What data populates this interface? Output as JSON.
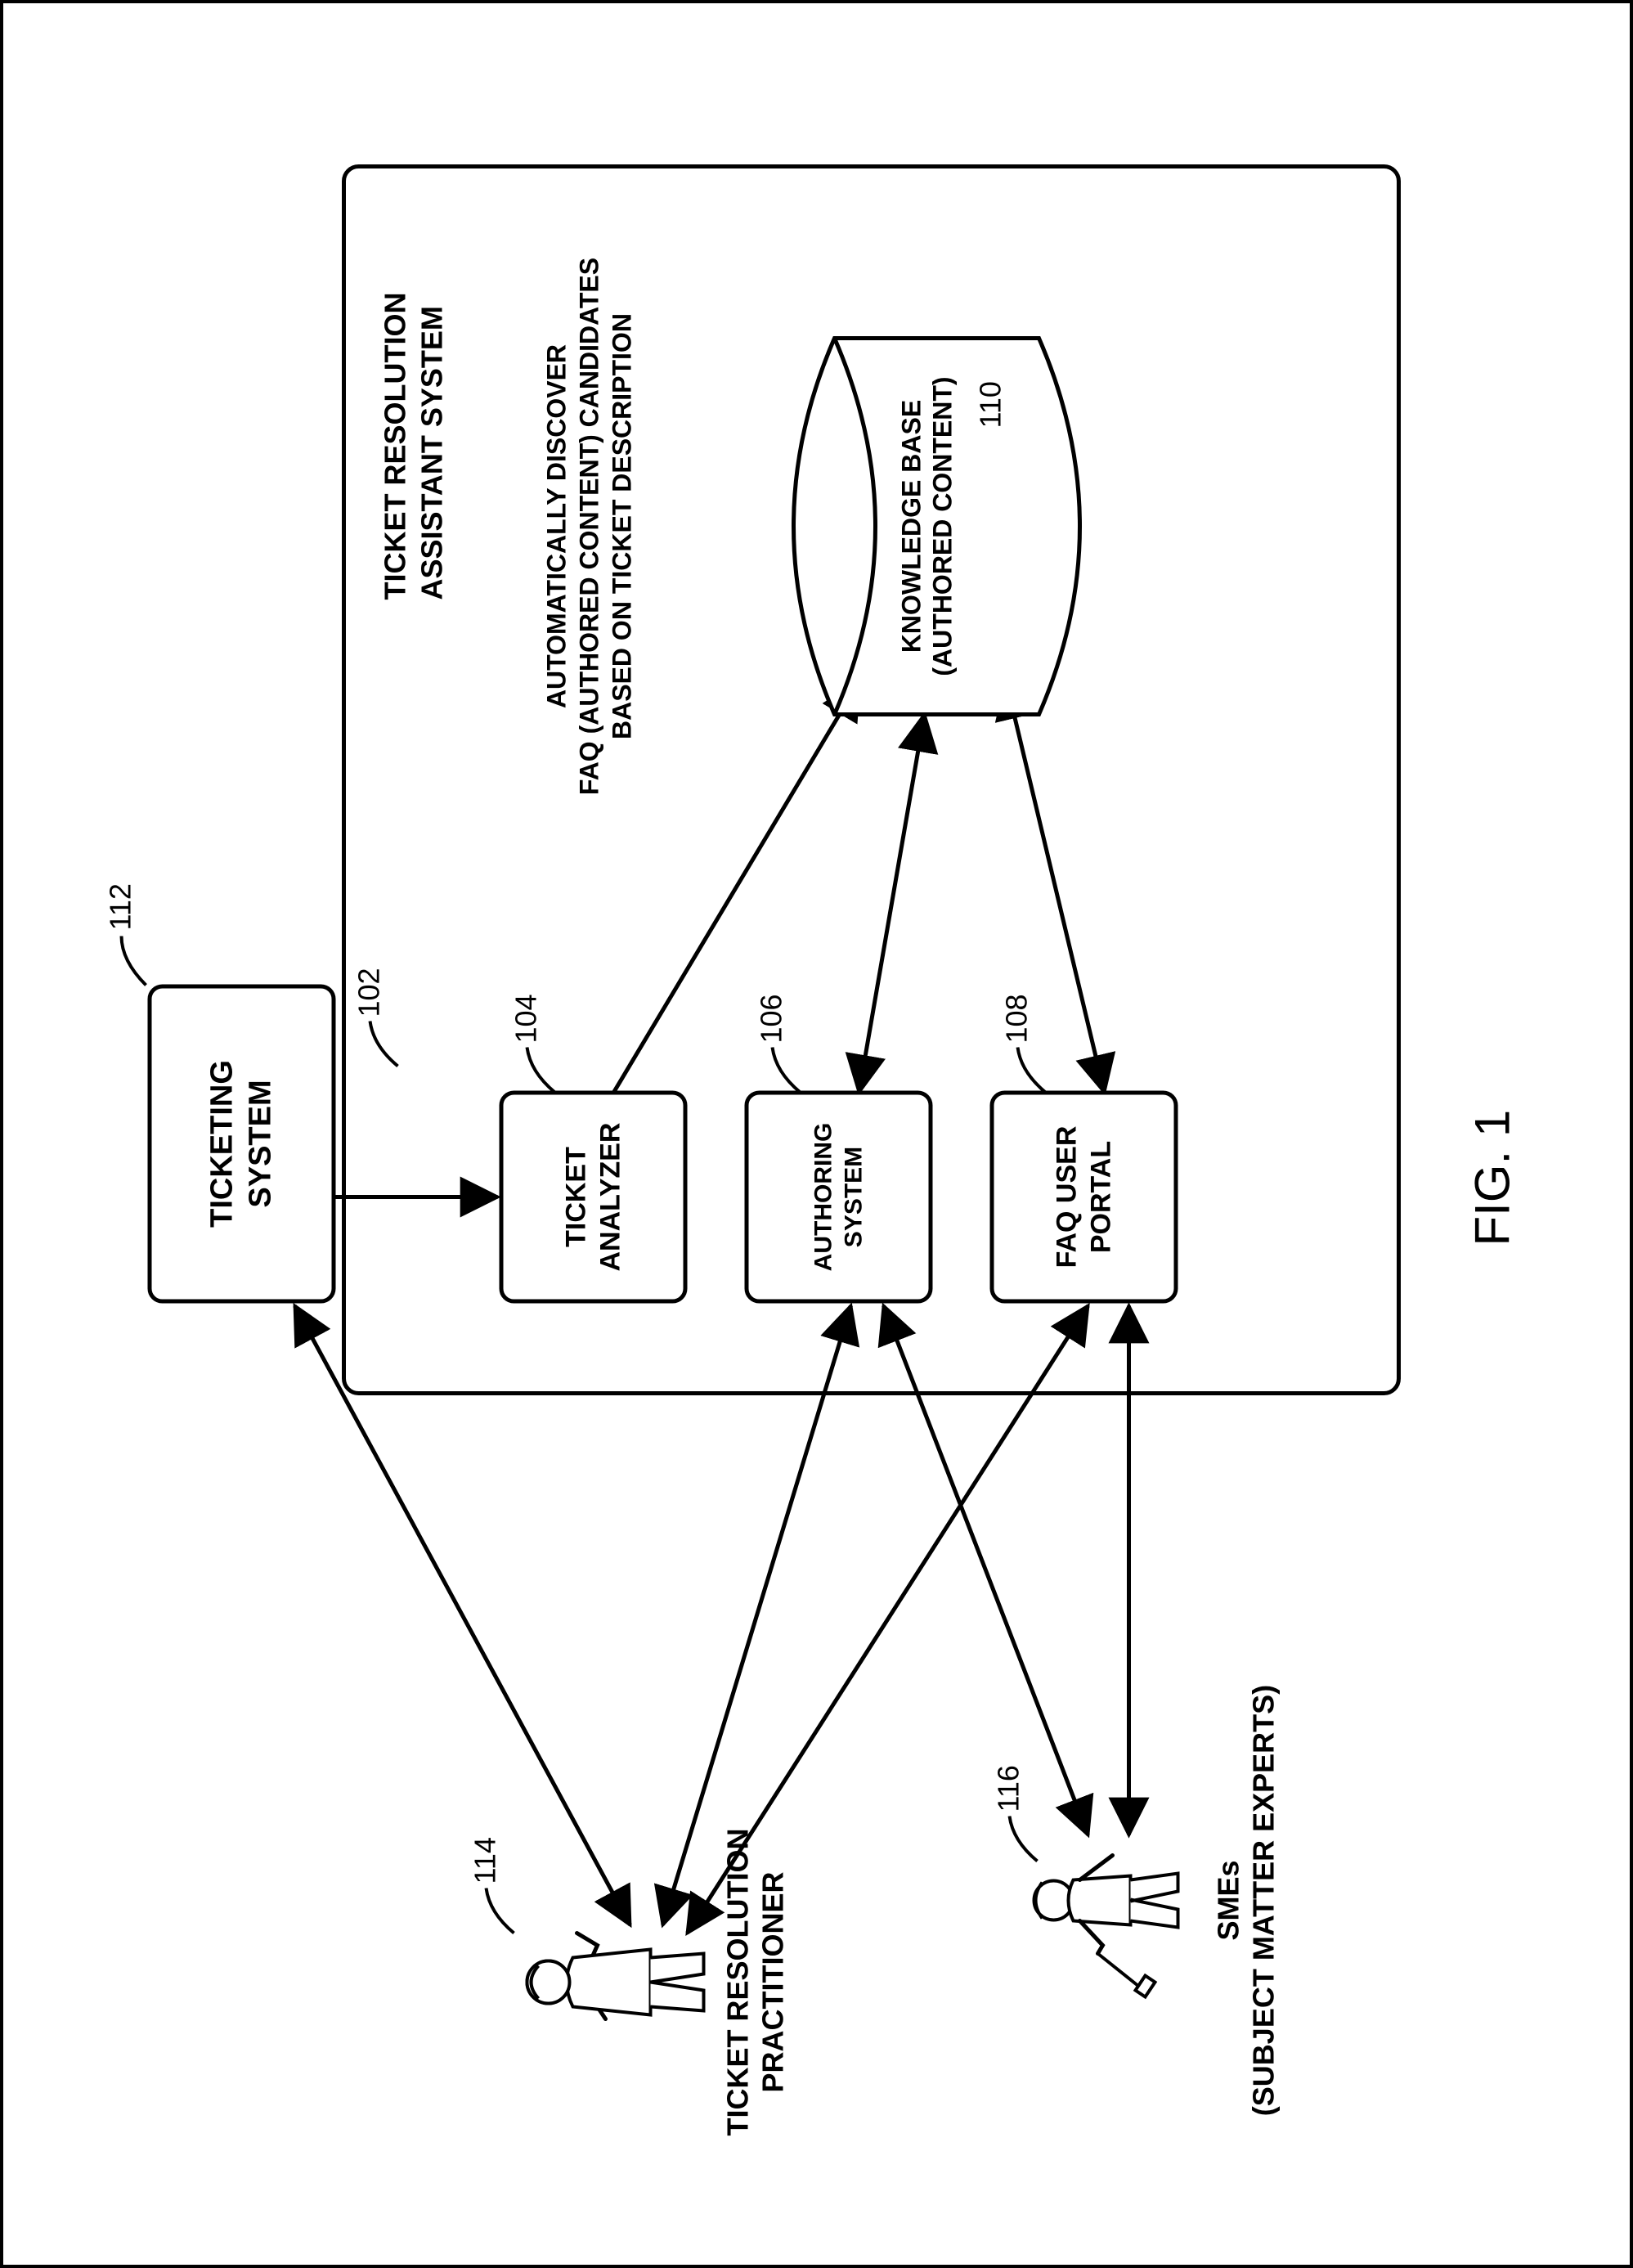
{
  "figure_label": "FIG. 1",
  "system_title": "TICKET RESOLUTION ASSISTANT SYSTEM",
  "boxes": {
    "ticketing_system": "TICKETING SYSTEM",
    "ticket_analyzer": "TICKET ANALYZER",
    "authoring_system": "AUTHORING SYSTEM",
    "faq_user_portal": "FAQ USER PORTAL"
  },
  "kb": {
    "line1": "KNOWLEDGE BASE",
    "line2": "(AUTHORED CONTENT)"
  },
  "discover": {
    "line1": "AUTOMATICALLY DISCOVER",
    "line2": "FAQ (AUTHORED CONTENT) CANDIDATES",
    "line3": "BASED ON TICKET DESCRIPTION"
  },
  "actors": {
    "practitioner": {
      "line1": "TICKET RESOLUTION",
      "line2": "PRACTITIONER"
    },
    "smes": {
      "line1": "SMEs",
      "line2": "(SUBJECT MATTER EXPERTS)"
    }
  },
  "refs": {
    "system": "102",
    "ticket_analyzer": "104",
    "authoring_system": "106",
    "faq_user_portal": "108",
    "knowledge_base": "110",
    "ticketing_system": "112",
    "practitioner": "114",
    "smes": "116"
  }
}
